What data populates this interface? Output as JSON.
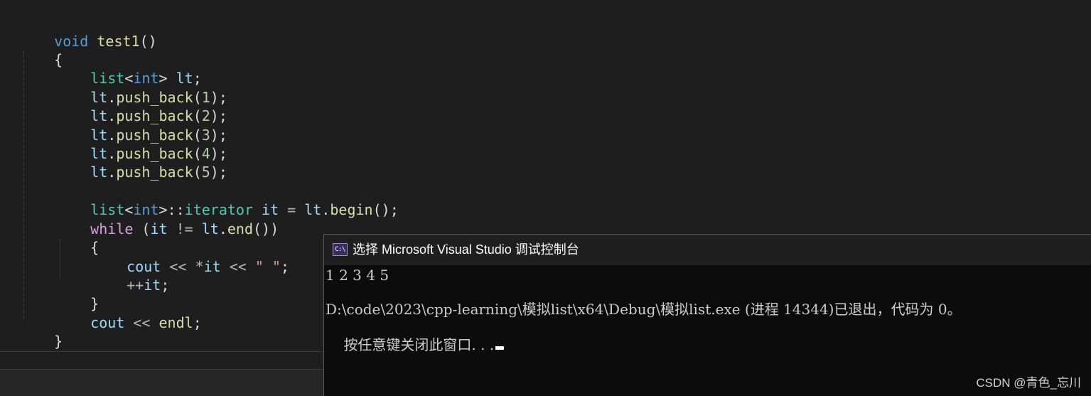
{
  "editor": {
    "lines": {
      "l1": {
        "kw_void": "void",
        "sp": " ",
        "fn_name": "test1",
        "parens": "()"
      },
      "l2": {
        "brace": "{"
      },
      "l3": {
        "type": "list",
        "lt1": "<",
        "int": "int",
        "gt1": ">",
        "sp": " ",
        "var": "lt",
        "semi": ";"
      },
      "l4": {
        "var": "lt",
        "dot": ".",
        "fn": "push_back",
        "open": "(",
        "num": "1",
        "close": ");"
      },
      "l5": {
        "var": "lt",
        "dot": ".",
        "fn": "push_back",
        "open": "(",
        "num": "2",
        "close": ");"
      },
      "l6": {
        "var": "lt",
        "dot": ".",
        "fn": "push_back",
        "open": "(",
        "num": "3",
        "close": ");"
      },
      "l7": {
        "var": "lt",
        "dot": ".",
        "fn": "push_back",
        "open": "(",
        "num": "4",
        "close": ");"
      },
      "l8": {
        "var": "lt",
        "dot": ".",
        "fn": "push_back",
        "open": "(",
        "num": "5",
        "close": ");"
      },
      "l10": {
        "type": "list",
        "lt1": "<",
        "int": "int",
        "gt1": ">",
        "scope": "::",
        "iter": "iterator",
        "sp": " ",
        "var_it": "it",
        "assign": " = ",
        "var_lt": "lt",
        "dot": ".",
        "fn": "begin",
        "tail": "();"
      },
      "l11": {
        "kw": "while",
        "open": " (",
        "var_it": "it",
        "neq": " != ",
        "var_lt": "lt",
        "dot": ".",
        "fn": "end",
        "tail": "())"
      },
      "l12": {
        "brace": "{"
      },
      "l13": {
        "var": "cout",
        "op1": " << ",
        "star": "*",
        "var_it": "it",
        "op2": " << ",
        "str": "\" \"",
        "semi": ";"
      },
      "l14": {
        "inc": "++",
        "var_it": "it",
        "semi": ";"
      },
      "l15": {
        "brace": "}"
      },
      "l16": {
        "var": "cout",
        "op": " << ",
        "endl": "endl",
        "semi": ";"
      },
      "l17": {
        "brace": "}"
      }
    }
  },
  "console": {
    "icon_text": "C:\\",
    "title": "选择 Microsoft Visual Studio 调试控制台",
    "output": "1 2 3 4 5",
    "exit_message": "D:\\code\\2023\\cpp-learning\\模拟list\\x64\\Debug\\模拟list.exe (进程 14344)已退出，代码为 0。",
    "prompt": "按任意键关闭此窗口. . ."
  },
  "watermark": "CSDN @青色_忘川"
}
